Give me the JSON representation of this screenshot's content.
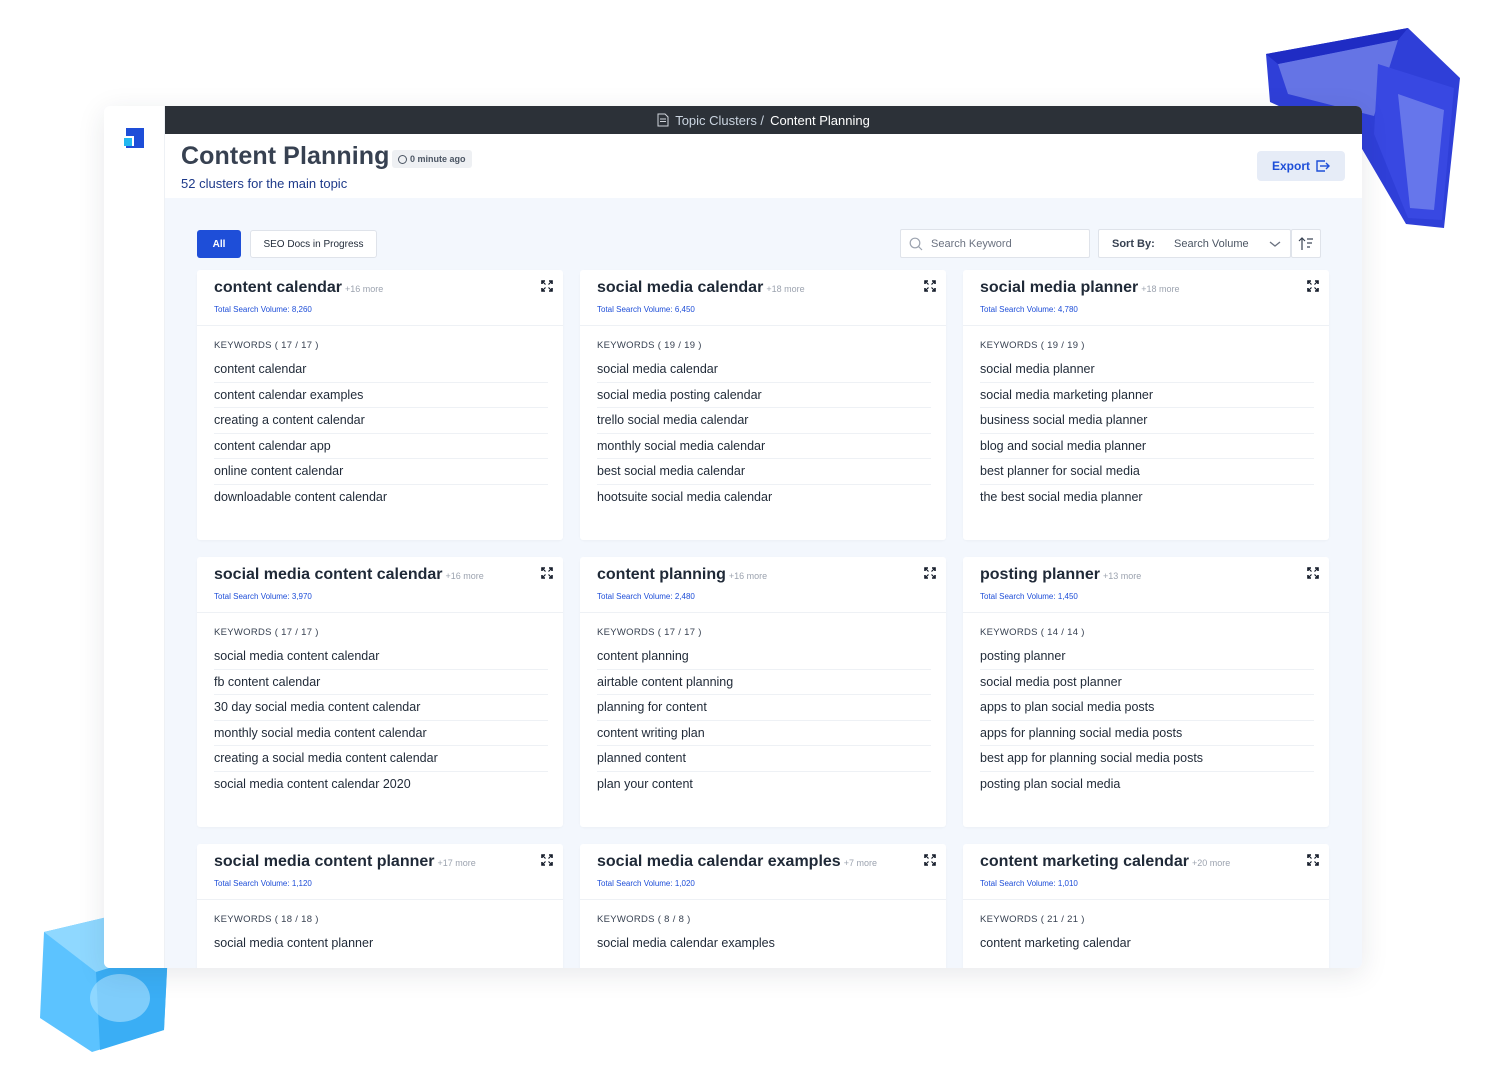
{
  "breadcrumb": {
    "parent": "Topic Clusters /",
    "current": "Content Planning"
  },
  "header": {
    "title": "Content Planning",
    "updated": "0 minute ago",
    "subtitle": "52 clusters for the main topic",
    "export_label": "Export"
  },
  "filters": {
    "all_label": "All",
    "seo_label": "SEO Docs in Progress"
  },
  "search": {
    "placeholder": "Search Keyword"
  },
  "sort": {
    "label": "Sort By:",
    "value": "Search Volume"
  },
  "clusters": [
    {
      "title": "content calendar",
      "more": "+16 more",
      "volume": "Total Search Volume: 8,260",
      "keywords_label": "KEYWORDS ( 17 / 17 )",
      "keywords": [
        "content calendar",
        "content calendar examples",
        "creating a content calendar",
        "content calendar app",
        "online content calendar",
        "downloadable content calendar"
      ]
    },
    {
      "title": "social media calendar",
      "more": "+18 more",
      "volume": "Total Search Volume: 6,450",
      "keywords_label": "KEYWORDS ( 19 / 19 )",
      "keywords": [
        "social media calendar",
        "social media posting calendar",
        "trello social media calendar",
        "monthly social media calendar",
        "best social media calendar",
        "hootsuite social media calendar"
      ]
    },
    {
      "title": "social media planner",
      "more": "+18 more",
      "volume": "Total Search Volume: 4,780",
      "keywords_label": "KEYWORDS ( 19 / 19 )",
      "keywords": [
        "social media planner",
        "social media marketing planner",
        "business social media planner",
        "blog and social media planner",
        "best planner for social media",
        "the best social media planner"
      ]
    },
    {
      "title": "social media content calendar",
      "more": "+16 more",
      "volume": "Total Search Volume: 3,970",
      "keywords_label": "KEYWORDS ( 17 / 17 )",
      "keywords": [
        "social media content calendar",
        "fb content calendar",
        "30 day social media content calendar",
        "monthly social media content calendar",
        "creating a social media content calendar",
        "social media content calendar 2020"
      ]
    },
    {
      "title": "content planning",
      "more": "+16 more",
      "volume": "Total Search Volume: 2,480",
      "keywords_label": "KEYWORDS ( 17 / 17 )",
      "keywords": [
        "content planning",
        "airtable content planning",
        "planning for content",
        "content writing plan",
        "planned content",
        "plan your content"
      ]
    },
    {
      "title": "posting planner",
      "more": "+13 more",
      "volume": "Total Search Volume: 1,450",
      "keywords_label": "KEYWORDS ( 14 / 14 )",
      "keywords": [
        "posting planner",
        "social media post planner",
        "apps to plan social media posts",
        "apps for planning social media posts",
        "best app for planning social media posts",
        "posting plan social media"
      ]
    },
    {
      "title": "social media content planner",
      "more": "+17 more",
      "volume": "Total Search Volume: 1,120",
      "keywords_label": "KEYWORDS ( 18 / 18 )",
      "keywords": [
        "social media content planner"
      ]
    },
    {
      "title": "social media calendar examples",
      "more": "+7 more",
      "volume": "Total Search Volume: 1,020",
      "keywords_label": "KEYWORDS ( 8 / 8 )",
      "keywords": [
        "social media calendar examples"
      ]
    },
    {
      "title": "content marketing calendar",
      "more": "+20 more",
      "volume": "Total Search Volume: 1,010",
      "keywords_label": "KEYWORDS ( 21 / 21 )",
      "keywords": [
        "content marketing calendar"
      ]
    }
  ]
}
